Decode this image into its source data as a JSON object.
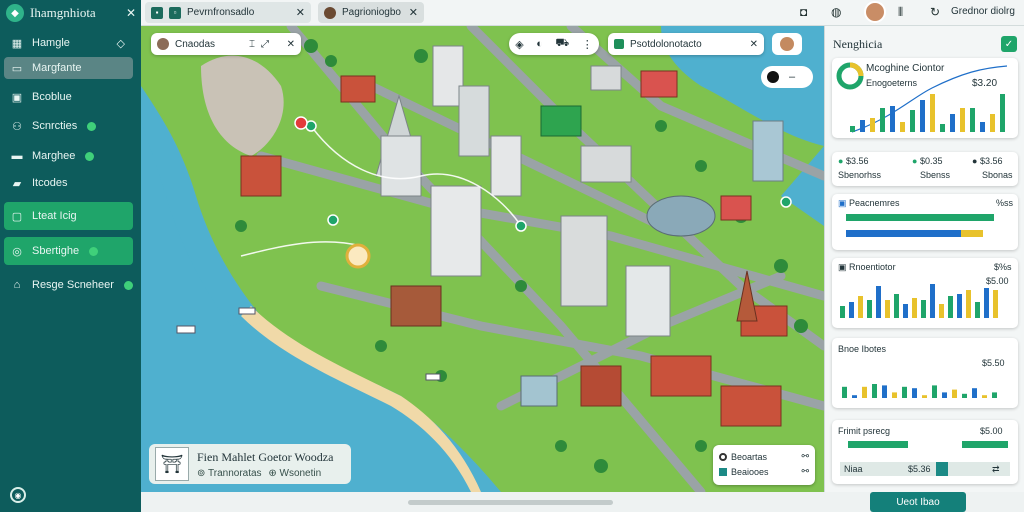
{
  "sidebar": {
    "title": "Ihamgnhiota",
    "items": [
      {
        "label": "Hamgle",
        "icon": "grid-icon"
      },
      {
        "label": "Margfante",
        "icon": "bookmark-icon"
      },
      {
        "label": "Bcoblue",
        "icon": "calendar-icon"
      },
      {
        "label": "Scnrcties",
        "icon": "people-icon"
      },
      {
        "label": "Marghee",
        "icon": "monitor-icon"
      },
      {
        "label": "Itcodes",
        "icon": "car-icon"
      },
      {
        "label": "Lteat Icig",
        "icon": "map-icon"
      },
      {
        "label": "Sbertighe",
        "icon": "globe-icon"
      },
      {
        "label": "Resge Scneheer",
        "icon": "layers-icon"
      }
    ]
  },
  "tabs": [
    {
      "label": "Pevrnfronsadlo"
    },
    {
      "label": "Pagrioniogbo"
    }
  ],
  "topbar_user": "Grednor diolrg",
  "map": {
    "search_value": "Cnaodas",
    "filter_value": "Psotdolonotacto",
    "card_title": "Fien Mahlet Goetor Woodza",
    "card_subtitle": "Trannoratas",
    "card_link": "Wsonetin",
    "legend": [
      {
        "label": "Beoartas"
      },
      {
        "label": "Beaiooes"
      }
    ]
  },
  "panel": {
    "title": "Nenghicia",
    "stat_card": {
      "title": "Mcoghine Ciontor",
      "value": "$3.20",
      "sub": "Enogoeterns"
    },
    "metrics": [
      {
        "label": "$3.56",
        "value": "$3.56"
      },
      {
        "label": "$0.35",
        "value": "$0.35"
      },
      {
        "label": "$3.56",
        "value": "$3.56"
      }
    ],
    "metric_sub": [
      "Sbenorhss",
      "Sbenss",
      "Sbonas"
    ],
    "bars_card": {
      "title": "Peacnemres",
      "right": "%ss"
    },
    "column_card": {
      "title": "Rnoentiotor",
      "right": "$%s",
      "value": "$5.00"
    },
    "price_card": {
      "title": "Bnoe Ibotes",
      "value": "$5.50"
    },
    "bottom_card": {
      "title": "Frimit psrecg",
      "value": "$5.00",
      "amount": "$5.36",
      "label": "Niaa"
    }
  },
  "bottom": {
    "button": "Ueot Ibao"
  },
  "chart_data": [
    {
      "type": "bar",
      "title": "Mcoghine Ciontor",
      "values": [
        15,
        30,
        35,
        60,
        65,
        25,
        55,
        80,
        95,
        20,
        45,
        60,
        60,
        25,
        45,
        95
      ]
    },
    {
      "type": "bar",
      "title": "Peacnemres",
      "series": [
        {
          "values": [
            88,
            60
          ]
        },
        {
          "values": [
            60,
            55
          ]
        },
        {
          "values": [
            0,
            22
          ]
        }
      ]
    },
    {
      "type": "bar",
      "title": "Rnoentiotor",
      "values": [
        30,
        40,
        55,
        45,
        80,
        45,
        60,
        35,
        50,
        45,
        85,
        35,
        55,
        60,
        70,
        40,
        75,
        70
      ]
    },
    {
      "type": "bar",
      "title": "Bnoe Ibotes",
      "values": [
        40,
        10,
        40,
        50,
        45,
        20,
        40,
        35,
        10,
        45,
        20,
        30,
        15,
        35,
        10,
        20
      ]
    }
  ],
  "colors": {
    "sidebar": "#0d5c5c",
    "accent": "#1fa56a",
    "blue": "#1f6fc9",
    "yellow": "#e8c22c"
  }
}
